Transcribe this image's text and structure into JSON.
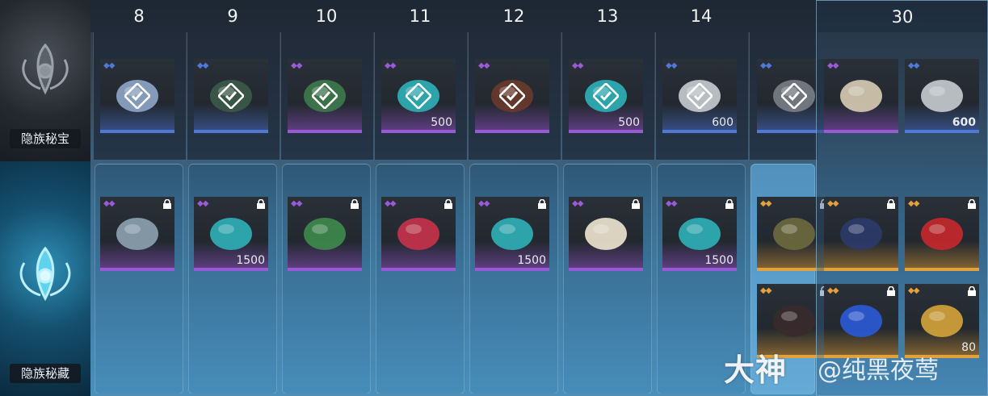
{
  "tiers": {
    "free_label": "隐族秘宝",
    "paid_label": "隐族秘藏"
  },
  "days": [
    {
      "num": "8",
      "free": {
        "count": "",
        "rarity": "blue",
        "claimed": true,
        "icon": "cat-portrait-icon"
      },
      "paid": [
        {
          "count": "",
          "rarity": "purple",
          "icon": "painting-scroll-icon"
        }
      ]
    },
    {
      "num": "9",
      "free": {
        "count": "",
        "rarity": "blue",
        "claimed": true,
        "icon": "robe-outfit-icon"
      },
      "paid": [
        {
          "count": "1500",
          "rarity": "purple",
          "icon": "cyan-feather-icon"
        }
      ]
    },
    {
      "num": "10",
      "free": {
        "count": "",
        "rarity": "purple",
        "claimed": true,
        "icon": "green-scroll-icon"
      },
      "paid": [
        {
          "count": "",
          "rarity": "purple",
          "icon": "treasure-chest-icon"
        }
      ]
    },
    {
      "num": "11",
      "free": {
        "count": "500",
        "rarity": "purple",
        "claimed": true,
        "icon": "cyan-feather-icon"
      },
      "paid": [
        {
          "count": "",
          "rarity": "purple",
          "icon": "red-charm-icon"
        }
      ]
    },
    {
      "num": "12",
      "free": {
        "count": "",
        "rarity": "purple",
        "claimed": true,
        "icon": "frame-card-icon"
      },
      "paid": [
        {
          "count": "1500",
          "rarity": "purple",
          "icon": "cyan-feather-icon"
        }
      ]
    },
    {
      "num": "13",
      "free": {
        "count": "500",
        "rarity": "purple",
        "claimed": true,
        "icon": "cyan-feather-icon"
      },
      "paid": [
        {
          "count": "",
          "rarity": "purple",
          "icon": "sticker-girl-icon"
        }
      ]
    },
    {
      "num": "14",
      "free": {
        "count": "600",
        "rarity": "blue",
        "claimed": true,
        "icon": "silver-coin-icon"
      },
      "paid": [
        {
          "count": "1500",
          "rarity": "purple",
          "icon": "cyan-feather-icon"
        }
      ]
    },
    {
      "num": "",
      "free": {
        "count": "",
        "rarity": "blue",
        "claimed": true,
        "icon": "sword-icon"
      },
      "paid": [
        {
          "count": "",
          "rarity": "gold",
          "icon": "mount-vehicle-icon"
        },
        {
          "count": "",
          "rarity": "gold",
          "icon": "dark-hood-icon"
        }
      ]
    }
  ],
  "final_day": {
    "num": "30",
    "free": [
      {
        "count": "",
        "rarity": "purple",
        "icon": "blue-robe-icon"
      },
      {
        "count": "600",
        "rarity": "blue",
        "icon": "silver-coin-icon"
      }
    ],
    "paid": [
      {
        "count": "",
        "rarity": "gold",
        "icon": "dark-armor-icon"
      },
      {
        "count": "",
        "rarity": "gold",
        "icon": "red-lantern-icon"
      },
      {
        "count": "",
        "rarity": "gold",
        "icon": "blue-crystal-icon"
      },
      {
        "count": "80",
        "rarity": "gold",
        "icon": "gold-bars-icon"
      }
    ]
  },
  "watermark": {
    "brand": "大神",
    "handle": "@纯黑夜莺"
  },
  "colors": {
    "blue": "#4f78d8",
    "purple": "#9a5ad6",
    "gold": "#e2a13a"
  }
}
